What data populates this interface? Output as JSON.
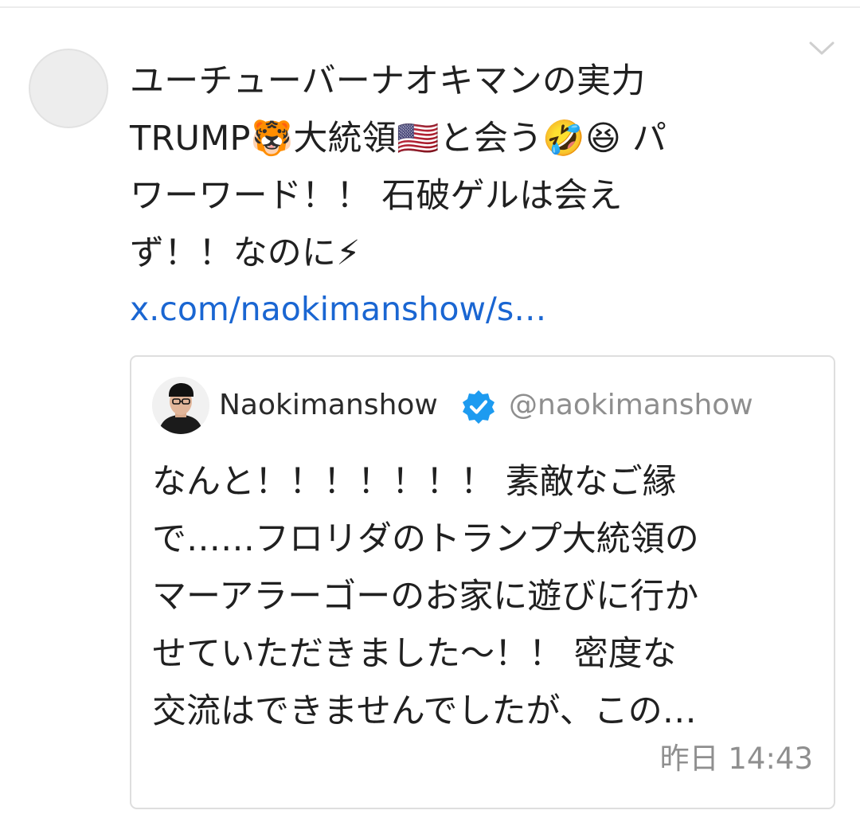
{
  "post": {
    "text": "ユーチューバーナオキマンの実力\nTRUMP🐯大統領🇺🇸と会う🤣😆 パ\nワーワード！！ 石破ゲルは会え\nず！！なのに⚡",
    "link": "x.com/naokimanshow/s…",
    "menu_icon": "chevron-down-icon",
    "avatar_icon": "profile-placeholder-icon"
  },
  "quote": {
    "name": "Naokimanshow",
    "handle": "@naokimanshow",
    "verified_icon": "verified-badge-icon",
    "text": "なんと！！！！！！！ 素敵なご縁\nで……フロリダのトランプ大統領の\nマーアラーゴーのお家に遊びに行か\nせていただきました〜！！ 密度な\n交流はできませんでしたが、この…",
    "time": "昨日 14:43"
  },
  "colors": {
    "link": "#1a66d2",
    "verified": "#1d9bf0",
    "secondary_text": "#8e8e8e",
    "border": "#dedede"
  }
}
